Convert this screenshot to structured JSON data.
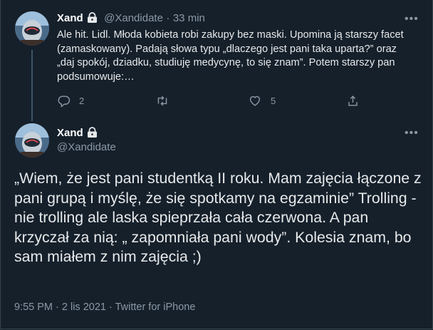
{
  "tweet1": {
    "name": "Xand",
    "handle": "@Xandidate",
    "separator": "·",
    "time": "33 min",
    "text": "Ale hit. Lidl. Młoda kobieta robi zakupy bez maski. Upomina ją starszy facet (zamaskowany). Padają słowa typu „dlaczego jest pani taka uparta?” oraz „daj spokój, dziadku, studiuję medycynę, to się znam”. Potem starszy pan podsumowuje:…",
    "replies": "2",
    "likes": "5",
    "more": "•••"
  },
  "tweet2": {
    "name": "Xand",
    "handle": "@Xandidate",
    "text": "„Wiem, że jest pani studentką II roku. Mam zajęcia łączone z pani grupą i myślę, że się spotkamy na egzaminie” Trolling - nie trolling ale laska spieprzała cała czerwona. A pan krzyczał za nią: „ zapomniała pani wody”. Kolesia znam, bo sam miałem z nim zajęcia ;)",
    "more": "•••",
    "timestamp": "9:55 PM · 2 lis 2021 · Twitter for iPhone"
  },
  "icons": {
    "lock": "lock-icon",
    "reply": "reply-icon",
    "retweet": "retweet-icon",
    "like": "heart-icon",
    "share": "share-icon",
    "more": "more-icon"
  },
  "colors": {
    "background": "#15202b",
    "text": "#e7e9ea",
    "secondary": "#8b98a5"
  }
}
